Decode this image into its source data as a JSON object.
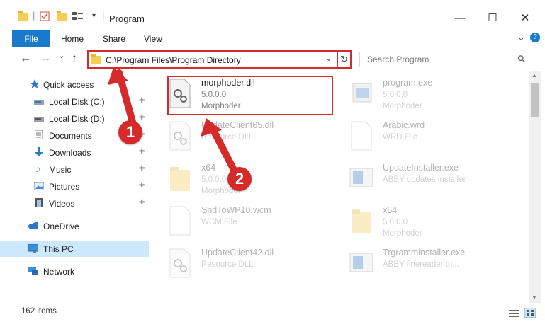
{
  "window": {
    "title": "Program",
    "minimize_glyph": "—",
    "maximize_glyph": "☐",
    "close_glyph": "✕"
  },
  "ribbon": {
    "tabs": [
      "File",
      "Home",
      "Share",
      "View"
    ],
    "collapse_glyph": "⌄",
    "help_glyph": "?"
  },
  "nav": {
    "back_glyph": "←",
    "forward_glyph": "→",
    "recent_glyph": "⌄",
    "up_glyph": "↑",
    "address": "C:\\Program Files\\Program Directory",
    "address_dropdown_glyph": "⌄",
    "refresh_glyph": "↻",
    "search_placeholder": "Search Program",
    "search_glyph": "⚲"
  },
  "sidebar": {
    "items": [
      {
        "label": "Quick access",
        "icon": "star-icon",
        "pinned": false
      },
      {
        "label": "Local Disk (C:)",
        "icon": "drive-icon",
        "pinned": true
      },
      {
        "label": "Local Disk (D:)",
        "icon": "drive-icon",
        "pinned": true
      },
      {
        "label": "Documents",
        "icon": "documents-icon",
        "pinned": true
      },
      {
        "label": "Downloads",
        "icon": "downloads-icon",
        "pinned": true
      },
      {
        "label": "Music",
        "icon": "music-icon",
        "pinned": true
      },
      {
        "label": "Pictures",
        "icon": "pictures-icon",
        "pinned": true
      },
      {
        "label": "Videos",
        "icon": "videos-icon",
        "pinned": true
      },
      {
        "label": "OneDrive",
        "icon": "cloud-icon",
        "pinned": false
      },
      {
        "label": "This PC",
        "icon": "computer-icon",
        "pinned": false
      },
      {
        "label": "Network",
        "icon": "network-icon",
        "pinned": false
      }
    ],
    "pin_glyph": "📌"
  },
  "files": [
    {
      "name": "morphoder.dll",
      "line2": "5.0.0.0",
      "line3": "Morphoder",
      "icon": "dll-icon"
    },
    {
      "name": "program.exe",
      "line2": "5.0.0.0",
      "line3": "Morphoder",
      "icon": "exe-icon"
    },
    {
      "name": "UpdateClient65.dll",
      "line2": "Resource DLL",
      "line3": "",
      "icon": "dll-icon"
    },
    {
      "name": "Arabic.wrd",
      "line2": "WRD File",
      "line3": "",
      "icon": "file-icon"
    },
    {
      "name": "x64",
      "line2": "5.0.0.0",
      "line3": "Morphoder",
      "icon": "folder-icon"
    },
    {
      "name": "UpdateInstaller.exe",
      "line2": "ABBY updates installer",
      "line3": "",
      "icon": "installer-icon"
    },
    {
      "name": "SndToWP10.wcm",
      "line2": "WCM File",
      "line3": "",
      "icon": "file-icon"
    },
    {
      "name": "x64",
      "line2": "5.0.0.0",
      "line3": "Morphoder",
      "icon": "folder-icon"
    },
    {
      "name": "UpdateClient42.dll",
      "line2": "Resource DLL",
      "line3": "",
      "icon": "dll-icon"
    },
    {
      "name": "Trgramminstaller.exe",
      "line2": "ABBY finereader tri...",
      "line3": "",
      "icon": "installer-icon"
    }
  ],
  "status": {
    "item_count": "162 items"
  },
  "callouts": {
    "badge1": "1",
    "badge2": "2",
    "color": "#d62a2a"
  }
}
